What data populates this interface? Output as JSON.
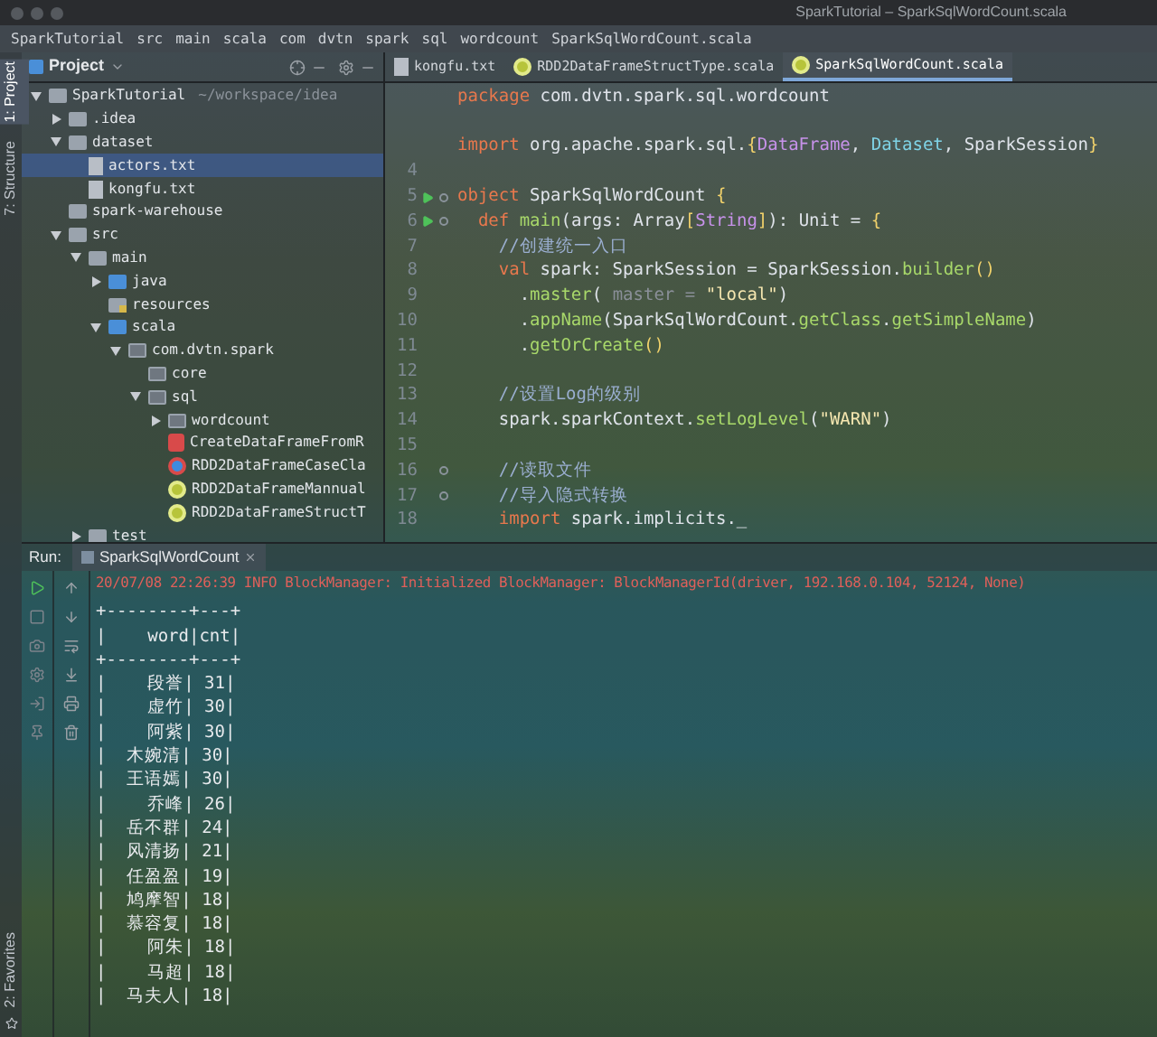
{
  "window": {
    "title": "SparkTutorial – SparkSqlWordCount.scala"
  },
  "breadcrumbs": [
    "SparkTutorial",
    "src",
    "main",
    "scala",
    "com",
    "dvtn",
    "spark",
    "sql",
    "wordcount",
    "SparkSqlWordCount.scala"
  ],
  "side_tabs": [
    {
      "label": "1: Project",
      "selected": true
    },
    {
      "label": "7: Structure",
      "selected": false
    }
  ],
  "bottom_side_tabs": [
    {
      "label": "2: Favorites",
      "selected": false
    }
  ],
  "project": {
    "title": "Project",
    "tree": [
      {
        "name": "SparkTutorial",
        "kind": "project",
        "hint": "~/workspace/idea",
        "expanded": true,
        "selected": false,
        "children": [
          {
            "name": ".idea",
            "kind": "folder",
            "expanded": false,
            "selected": false
          },
          {
            "name": "dataset",
            "kind": "folder",
            "expanded": true,
            "selected": false,
            "children": [
              {
                "name": "actors.txt",
                "kind": "text-file",
                "selected": true
              },
              {
                "name": "kongfu.txt",
                "kind": "text-file",
                "selected": false
              }
            ]
          },
          {
            "name": "spark-warehouse",
            "kind": "folder",
            "selected": false
          },
          {
            "name": "src",
            "kind": "folder",
            "expanded": true,
            "selected": false,
            "children": [
              {
                "name": "main",
                "kind": "folder",
                "expanded": true,
                "selected": false,
                "children": [
                  {
                    "name": "java",
                    "kind": "source-folder",
                    "expanded": false,
                    "selected": false
                  },
                  {
                    "name": "resources",
                    "kind": "resources-folder",
                    "selected": false
                  },
                  {
                    "name": "scala",
                    "kind": "source-folder",
                    "expanded": true,
                    "selected": false,
                    "children": [
                      {
                        "name": "com.dvtn.spark",
                        "kind": "package",
                        "expanded": true,
                        "selected": false,
                        "children": [
                          {
                            "name": "core",
                            "kind": "package",
                            "selected": false
                          },
                          {
                            "name": "sql",
                            "kind": "package",
                            "expanded": true,
                            "selected": false,
                            "children": [
                              {
                                "name": "wordcount",
                                "kind": "package",
                                "expanded": false,
                                "selected": false
                              },
                              {
                                "name": "CreateDataFrameFromR",
                                "kind": "scala-script",
                                "selected": false
                              },
                              {
                                "name": "RDD2DataFrameCaseCla",
                                "kind": "scala-class",
                                "selected": false
                              },
                              {
                                "name": "RDD2DataFrameMannual",
                                "kind": "scala-object",
                                "selected": false
                              },
                              {
                                "name": "RDD2DataFrameStructT",
                                "kind": "scala-object",
                                "selected": false
                              }
                            ]
                          }
                        ]
                      }
                    ]
                  }
                ]
              },
              {
                "name": "test",
                "kind": "folder",
                "expanded": false,
                "selected": false
              }
            ]
          }
        ]
      }
    ]
  },
  "editor": {
    "tabs": [
      {
        "label": "kongfu.txt",
        "kind": "text-file",
        "selected": false
      },
      {
        "label": "RDD2DataFrameStructType.scala",
        "kind": "scala-object",
        "selected": false
      },
      {
        "label": "SparkSqlWordCount.scala",
        "kind": "scala-object",
        "selected": true
      }
    ],
    "lines": [
      {
        "kind": "code",
        "tokens": [
          {
            "kind": "keyword",
            "text": "package"
          },
          {
            "kind": "plain",
            "text": " com.dvtn.spark.sql.wordcount"
          }
        ]
      },
      {
        "kind": "blank"
      },
      {
        "kind": "code",
        "tokens": [
          {
            "kind": "keyword",
            "text": "import"
          },
          {
            "kind": "plain",
            "text": " org.apache.spark.sql."
          },
          {
            "kind": "brace",
            "text": "{"
          },
          {
            "kind": "type",
            "text": "DataFrame"
          },
          {
            "kind": "plain",
            "text": ", "
          },
          {
            "kind": "trait",
            "text": "Dataset"
          },
          {
            "kind": "plain",
            "text": ", SparkSession"
          },
          {
            "kind": "brace",
            "text": "}"
          }
        ]
      },
      {
        "kind": "blank",
        "number": "4"
      },
      {
        "kind": "code",
        "number": "5",
        "run": true,
        "fold": true,
        "tokens": [
          {
            "kind": "keyword",
            "text": "object"
          },
          {
            "kind": "plain",
            "text": " SparkSqlWordCount "
          },
          {
            "kind": "brace",
            "text": "{"
          }
        ]
      },
      {
        "kind": "code",
        "number": "6",
        "run": true,
        "fold": true,
        "tokens": [
          {
            "kind": "keyword",
            "text": "  def"
          },
          {
            "kind": "method",
            "text": " main"
          },
          {
            "kind": "plain",
            "text": "(args: Array"
          },
          {
            "kind": "brace",
            "text": "["
          },
          {
            "kind": "type",
            "text": "String"
          },
          {
            "kind": "brace",
            "text": "]"
          },
          {
            "kind": "plain",
            "text": "): Unit = "
          },
          {
            "kind": "brace",
            "text": "{"
          }
        ]
      },
      {
        "kind": "code",
        "number": "7",
        "tokens": [
          {
            "kind": "comment",
            "text": "    //创建统一入口"
          }
        ]
      },
      {
        "kind": "code",
        "number": "8",
        "tokens": [
          {
            "kind": "keyword",
            "text": "    val"
          },
          {
            "kind": "plain",
            "text": " spark: SparkSession = SparkSession."
          },
          {
            "kind": "method",
            "text": "builder"
          },
          {
            "kind": "brace",
            "text": "()"
          }
        ]
      },
      {
        "kind": "code",
        "number": "9",
        "tokens": [
          {
            "kind": "plain",
            "text": "      ."
          },
          {
            "kind": "method",
            "text": "master"
          },
          {
            "kind": "plain",
            "text": "( "
          },
          {
            "kind": "hint",
            "text": "master ="
          },
          {
            "kind": "string",
            "text": " \"local\""
          },
          {
            "kind": "plain",
            "text": ")"
          }
        ]
      },
      {
        "kind": "code",
        "number": "10",
        "tokens": [
          {
            "kind": "plain",
            "text": "      ."
          },
          {
            "kind": "method",
            "text": "appName"
          },
          {
            "kind": "plain",
            "text": "(SparkSqlWordCount."
          },
          {
            "kind": "method",
            "text": "getClass"
          },
          {
            "kind": "plain",
            "text": "."
          },
          {
            "kind": "method",
            "text": "getSimpleName"
          },
          {
            "kind": "plain",
            "text": ")"
          }
        ]
      },
      {
        "kind": "code",
        "number": "11",
        "tokens": [
          {
            "kind": "plain",
            "text": "      ."
          },
          {
            "kind": "method",
            "text": "getOrCreate"
          },
          {
            "kind": "brace",
            "text": "()"
          }
        ]
      },
      {
        "kind": "blank",
        "number": "12"
      },
      {
        "kind": "code",
        "number": "13",
        "tokens": [
          {
            "kind": "comment",
            "text": "    //设置Log的级别"
          }
        ]
      },
      {
        "kind": "code",
        "number": "14",
        "tokens": [
          {
            "kind": "plain",
            "text": "    spark.sparkContext."
          },
          {
            "kind": "method",
            "text": "setLogLevel"
          },
          {
            "kind": "plain",
            "text": "("
          },
          {
            "kind": "string",
            "text": "\"WARN\""
          },
          {
            "kind": "plain",
            "text": ")"
          }
        ]
      },
      {
        "kind": "blank",
        "number": "15"
      },
      {
        "kind": "code",
        "number": "16",
        "fold": true,
        "tokens": [
          {
            "kind": "comment",
            "text": "    //读取文件"
          }
        ]
      },
      {
        "kind": "code",
        "number": "17",
        "fold": true,
        "tokens": [
          {
            "kind": "comment",
            "text": "    //导入隐式转换"
          }
        ]
      },
      {
        "kind": "code",
        "number": "18",
        "tokens": [
          {
            "kind": "keyword",
            "text": "    import"
          },
          {
            "kind": "plain",
            "text": " spark.implicits._"
          }
        ]
      }
    ]
  },
  "run": {
    "label": "Run:",
    "tab": "SparkSqlWordCount",
    "output": [
      {
        "kind": "log",
        "text": "20/07/08 22:26:39 INFO BlockManager: Initialized BlockManager: BlockManagerId(driver, 192.168.0.104, 52124, None)"
      },
      {
        "kind": "stdout",
        "text": "+--------+---+"
      },
      {
        "kind": "stdout",
        "text": "|    word|cnt|"
      },
      {
        "kind": "stdout",
        "text": "+--------+---+"
      },
      {
        "kind": "stdout",
        "text": "|    段誉| 31|"
      },
      {
        "kind": "stdout",
        "text": "|    虚竹| 30|"
      },
      {
        "kind": "stdout",
        "text": "|    阿紫| 30|"
      },
      {
        "kind": "stdout",
        "text": "|  木婉清| 30|"
      },
      {
        "kind": "stdout",
        "text": "|  王语嫣| 30|"
      },
      {
        "kind": "stdout",
        "text": "|    乔峰| 26|"
      },
      {
        "kind": "stdout",
        "text": "|  岳不群| 24|"
      },
      {
        "kind": "stdout",
        "text": "|  风清扬| 21|"
      },
      {
        "kind": "stdout",
        "text": "|  任盈盈| 19|"
      },
      {
        "kind": "stdout",
        "text": "|  鸠摩智| 18|"
      },
      {
        "kind": "stdout",
        "text": "|  慕容复| 18|"
      },
      {
        "kind": "stdout",
        "text": "|    阿朱| 18|"
      },
      {
        "kind": "stdout",
        "text": "|    马超| 18|"
      },
      {
        "kind": "stdout",
        "text": "|  马夫人| 18|"
      }
    ]
  }
}
